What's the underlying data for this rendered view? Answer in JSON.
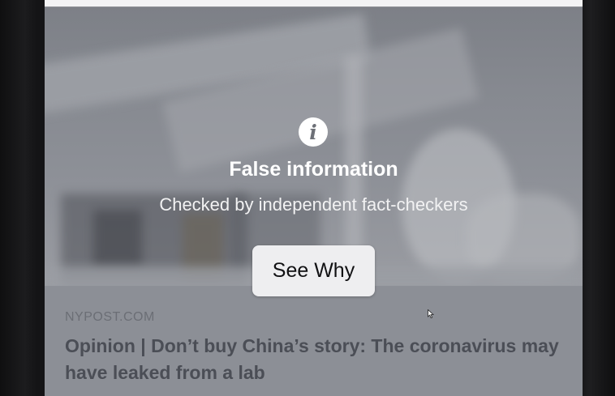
{
  "warning": {
    "icon": "info-icon",
    "title": "False information",
    "subtitle": "Checked by independent fact-checkers",
    "button_label": "See Why"
  },
  "link_preview": {
    "domain": "NYPOST.COM",
    "headline": "Opinion | Don’t buy China’s story: The coronavirus may have leaked from a lab"
  },
  "colors": {
    "overlay_gray": "#8a8d94",
    "button_bg": "#eeeef0",
    "title_text": "#ffffff",
    "headline_text": "#4b4e56"
  }
}
